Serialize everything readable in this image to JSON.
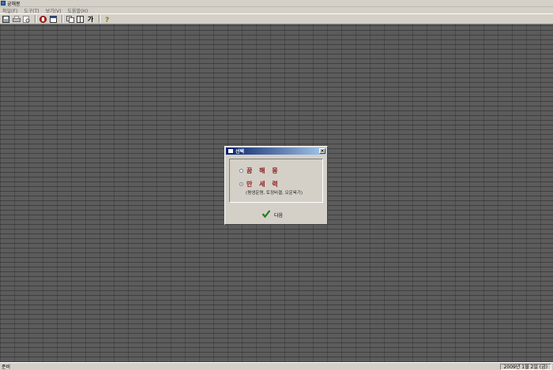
{
  "window": {
    "title": "궁해몽"
  },
  "menu": [
    "파일(F)",
    "도구(T)",
    "보기(V)",
    "도움말(H)"
  ],
  "toolbar": {
    "buttons": [
      "save-icon",
      "print-icon",
      "preview-icon",
      "stop-icon",
      "calendar-icon",
      "copy-icon",
      "book-icon",
      "font-icon",
      "help-icon"
    ],
    "font_label": "가"
  },
  "dialog": {
    "title": "선택",
    "close_label": "×",
    "options": [
      {
        "label": "꿈 해 몽",
        "checked": false
      },
      {
        "label": "만 세 력",
        "checked": true,
        "description": "(평생운명, 토정비결, 오운육기)"
      }
    ],
    "next_label": "다음"
  },
  "status": {
    "left": "준비",
    "date": "2009년 1월 2일 (금)"
  }
}
